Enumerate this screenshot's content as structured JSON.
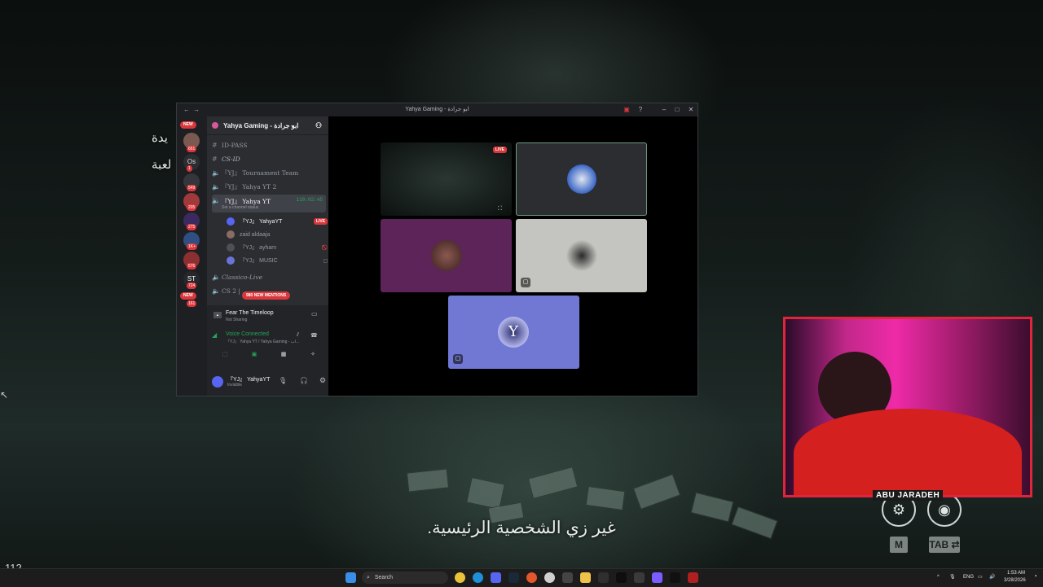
{
  "game": {
    "side_text_line1": "يدة",
    "side_text_line2": "لعبة",
    "subtitle": "غير زي الشخصية الرئيسية.",
    "corner_number": "112",
    "hud_keys": [
      "M",
      "TAB"
    ],
    "hud_icons": [
      "steam-icon",
      "discord-icon"
    ]
  },
  "discord": {
    "window_title": "Yahya Gaming - ابو جرادة",
    "server_name": "Yahya Gaming - ابو جرادة",
    "guild_badges": {
      "new_top": "NEW",
      "counts": [
        "661",
        "1",
        "549",
        "205",
        "275",
        "1K+",
        "576",
        "724",
        "161"
      ],
      "new_bottom": "NEW",
      "mentions": "980 NEW MENTIONS"
    },
    "channels": [
      {
        "name": "ID-PASS",
        "icon": "hash"
      },
      {
        "name": "CS-ID",
        "icon": "hash",
        "italic": true
      },
      {
        "name": "『YJ』 Tournament Team",
        "icon": "speaker"
      },
      {
        "name": "『YJ』 Yahya YT 2",
        "icon": "speaker"
      },
      {
        "name": "『YJ』 Yahya YT",
        "icon": "speaker",
        "timer": "110:02:45",
        "status": "Set a channel status"
      },
      {
        "name": "Classico-Live",
        "icon": "speaker"
      },
      {
        "name": "CS 2 | ...",
        "icon": "speaker"
      }
    ],
    "members": [
      {
        "name": "『YJ』 YahyaYT",
        "badge": "LIVE",
        "color": "#5865f2"
      },
      {
        "name": "zaid aldaaja",
        "color": "#8b6b63"
      },
      {
        "name": "『YJ』 ayham",
        "color": "#4e5058"
      },
      {
        "name": "『YJ』 MUSIC",
        "color": "#6874d8"
      }
    ],
    "activity": {
      "game": "Fear The Timeloop",
      "state": "Not Sharing"
    },
    "voice": {
      "status": "Voice Connected",
      "channel": "『YJ』 Yahya YT / Yahya Gaming - اب..."
    },
    "user": {
      "name": "『YJ』 YahyaYT",
      "status": "Invisible"
    },
    "stage": {
      "live_badge": "LIVE"
    }
  },
  "webcam": {
    "name_tag": "ABU JARADEH"
  },
  "taskbar": {
    "search_placeholder": "Search",
    "lang": "ENG",
    "time": "1:53 AM",
    "date": "3/28/2026"
  }
}
